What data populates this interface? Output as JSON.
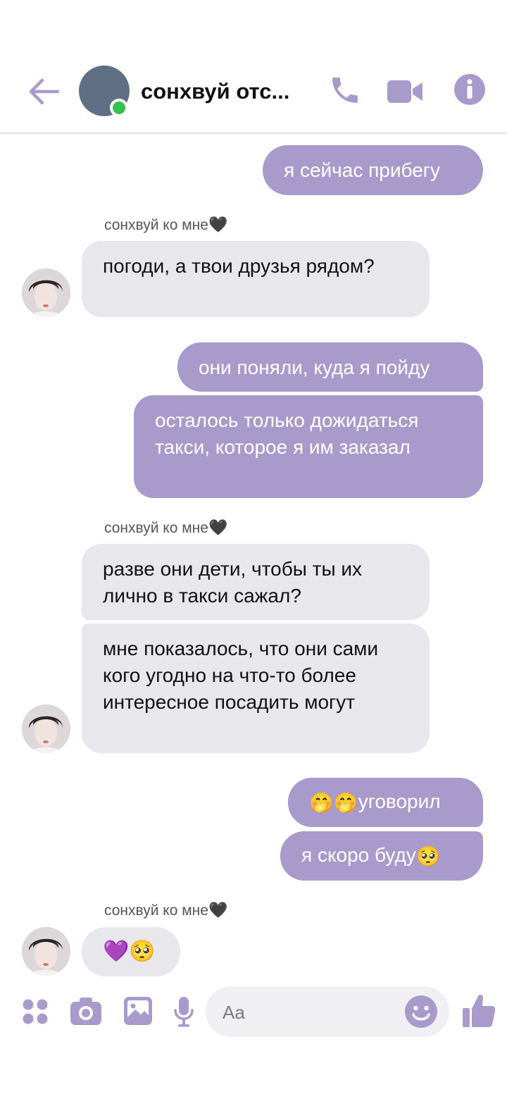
{
  "header": {
    "contact_name": "сонхвуй отс...",
    "icons": [
      "back-arrow-icon",
      "phone-icon",
      "video-camera-icon",
      "info-icon"
    ]
  },
  "messages": [
    {
      "dir": "out",
      "text": "я сейчас прибегу"
    },
    {
      "dir": "in",
      "sender": "сонхвуй ко мне",
      "sender_emoji": "🖤",
      "text": "погоди, а твои друзья рядом?"
    },
    {
      "dir": "out",
      "text": "они поняли, куда я пойду"
    },
    {
      "dir": "out",
      "text": "осталось только дожидаться такси, которое я им заказал"
    },
    {
      "dir": "in",
      "sender": "сонхвуй ко мне",
      "sender_emoji": "🖤",
      "text": "разве они дети, чтобы ты их лично в такси сажал?"
    },
    {
      "dir": "in",
      "text": "мне показалось, что они сами кого угодно на что-то более интересное посадить могут"
    },
    {
      "dir": "out",
      "text_prefix_emoji": "🤭🤭",
      "text": "уговорил"
    },
    {
      "dir": "out",
      "text": "я скоро буду",
      "text_suffix_emoji": "🥺"
    },
    {
      "dir": "in",
      "sender": "сонхвуй ко мне",
      "sender_emoji": "🖤",
      "emoji_only": "💜🥺"
    }
  ],
  "composer": {
    "placeholder": "Aa",
    "icons": [
      "apps-grid-icon",
      "camera-icon",
      "image-icon",
      "microphone-icon",
      "emoji-icon",
      "thumbs-up-icon"
    ]
  },
  "colors": {
    "accent": "#a89bcb",
    "outgoing_bubble": "#a89bcb",
    "incoming_bubble": "#e8e7ec",
    "online": "#33c24a"
  }
}
